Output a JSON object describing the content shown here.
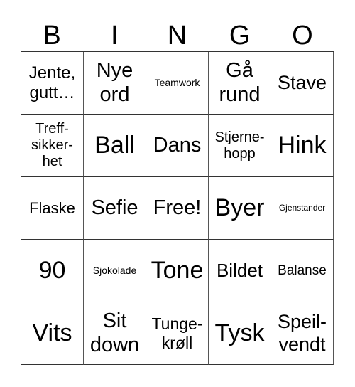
{
  "header": [
    "B",
    "I",
    "N",
    "G",
    "O"
  ],
  "cells": [
    {
      "text": "Jente,\ngutt…",
      "size": "l"
    },
    {
      "text": "Nye\nord",
      "size": "xl"
    },
    {
      "text": "Teamwork",
      "size": "xs"
    },
    {
      "text": "Gå\nrund",
      "size": "xl"
    },
    {
      "text": "Stave",
      "size": "l"
    },
    {
      "text": "Treff-\nsikker-\nhet",
      "size": "m"
    },
    {
      "text": "Ball",
      "size": "xxl"
    },
    {
      "text": "Dans",
      "size": "xl"
    },
    {
      "text": "Stjerne-\nhopp",
      "size": "m"
    },
    {
      "text": "Hink",
      "size": "xxl"
    },
    {
      "text": "Flaske",
      "size": "m"
    },
    {
      "text": "Sefie",
      "size": "xl"
    },
    {
      "text": "Free!",
      "size": "xl"
    },
    {
      "text": "Byer",
      "size": "xxl"
    },
    {
      "text": "Gjenstander",
      "size": "xxs"
    },
    {
      "text": "90",
      "size": "xxl"
    },
    {
      "text": "Sjokolade",
      "size": "xs"
    },
    {
      "text": "Tone",
      "size": "xxl"
    },
    {
      "text": "Bildet",
      "size": "l"
    },
    {
      "text": "Balanse",
      "size": "s"
    },
    {
      "text": "Vits",
      "size": "xxl"
    },
    {
      "text": "Sit\ndown",
      "size": "xl"
    },
    {
      "text": "Tunge-\nkrøll",
      "size": "l"
    },
    {
      "text": "Tysk",
      "size": "xxl"
    },
    {
      "text": "Speil-\nvendt",
      "size": "l"
    }
  ]
}
